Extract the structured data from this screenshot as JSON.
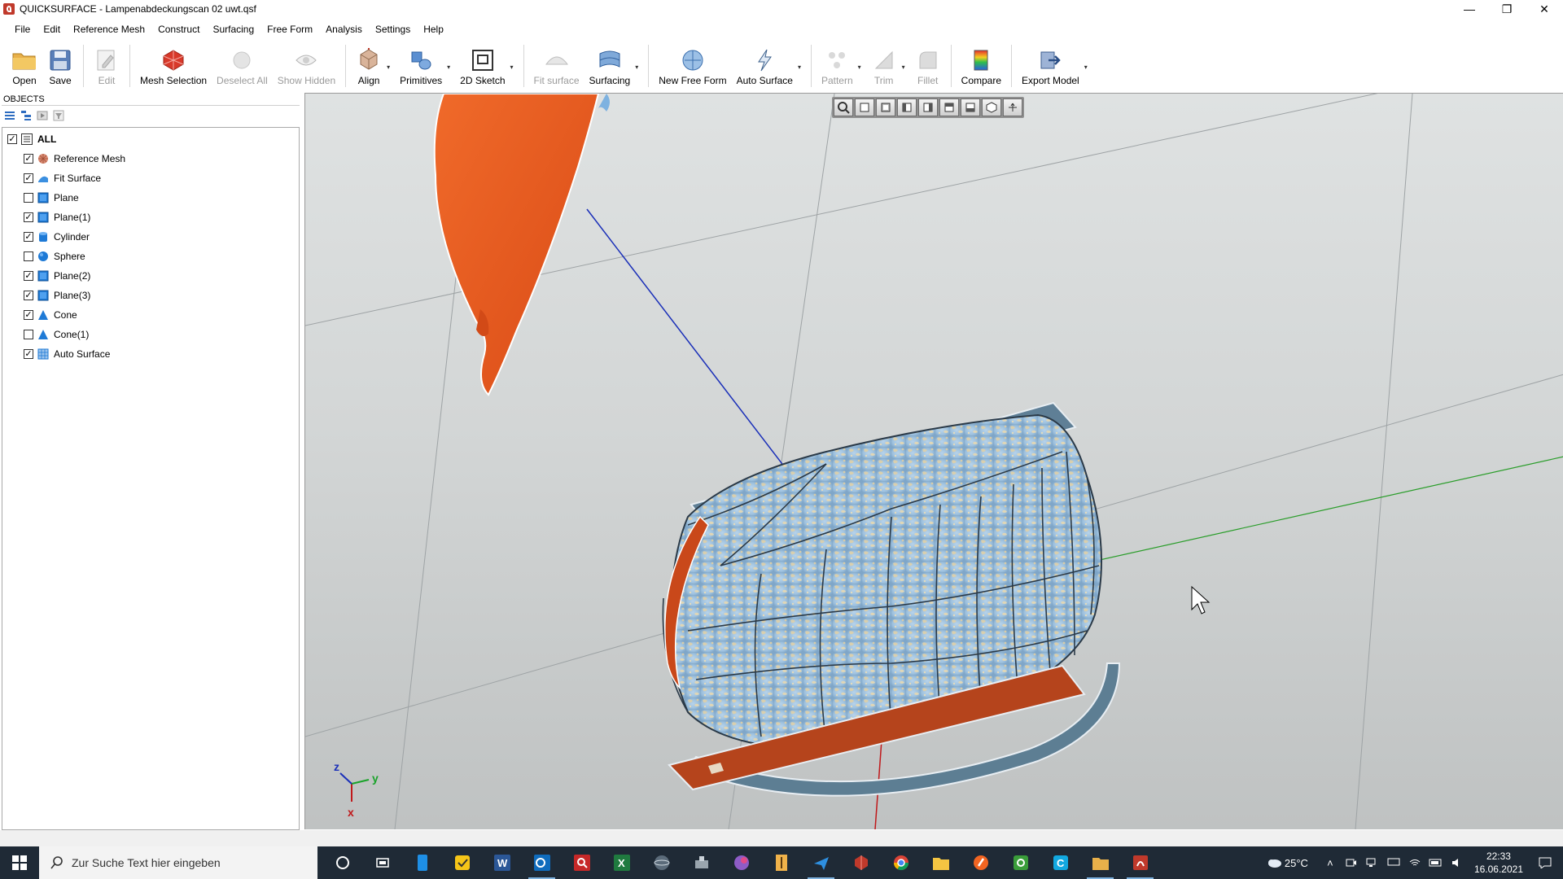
{
  "window": {
    "title": "QUICKSURFACE - Lampenabdeckungscan 02 uwt.qsf"
  },
  "menu": [
    "File",
    "Edit",
    "Reference Mesh",
    "Construct",
    "Surfacing",
    "Free Form",
    "Analysis",
    "Settings",
    "Help"
  ],
  "ribbon": {
    "open": "Open",
    "save": "Save",
    "edit": "Edit",
    "mesh_selection": "Mesh Selection",
    "deselect_all": "Deselect All",
    "show_hidden": "Show Hidden",
    "align": "Align",
    "primitives": "Primitives",
    "sketch2d": "2D Sketch",
    "fit_surface": "Fit surface",
    "surfacing": "Surfacing",
    "new_free_form": "New Free Form",
    "auto_surface": "Auto Surface",
    "pattern": "Pattern",
    "trim": "Trim",
    "fillet": "Fillet",
    "compare": "Compare",
    "export_model": "Export Model"
  },
  "objects_panel": {
    "header": "OBJECTS",
    "all_label": "ALL",
    "items": [
      {
        "label": "Reference Mesh",
        "checked": true,
        "icon": "mesh-icon"
      },
      {
        "label": "Fit Surface",
        "checked": true,
        "icon": "fit-surface-icon"
      },
      {
        "label": "Plane",
        "checked": false,
        "icon": "plane-icon"
      },
      {
        "label": "Plane(1)",
        "checked": true,
        "icon": "plane-icon"
      },
      {
        "label": "Cylinder",
        "checked": true,
        "icon": "cylinder-icon"
      },
      {
        "label": "Sphere",
        "checked": false,
        "icon": "sphere-icon"
      },
      {
        "label": "Plane(2)",
        "checked": true,
        "icon": "plane-icon"
      },
      {
        "label": "Plane(3)",
        "checked": true,
        "icon": "plane-icon"
      },
      {
        "label": "Cone",
        "checked": true,
        "icon": "cone-icon"
      },
      {
        "label": "Cone(1)",
        "checked": false,
        "icon": "cone-icon"
      },
      {
        "label": "Auto Surface",
        "checked": true,
        "icon": "auto-surface-icon"
      }
    ]
  },
  "axes": {
    "x": "x",
    "y": "y",
    "z": "z"
  },
  "taskbar": {
    "search_placeholder": "Zur Suche Text hier eingeben",
    "temperature": "25°C",
    "time": "22:33",
    "date": "16.06.2021"
  },
  "colors": {
    "accent": "#1e7ad6",
    "mesh_orange": "#e0541c",
    "surface_blue": "#a9c9e2",
    "plane_slate": "#5f7f96",
    "plane_rust": "#b5441c"
  }
}
